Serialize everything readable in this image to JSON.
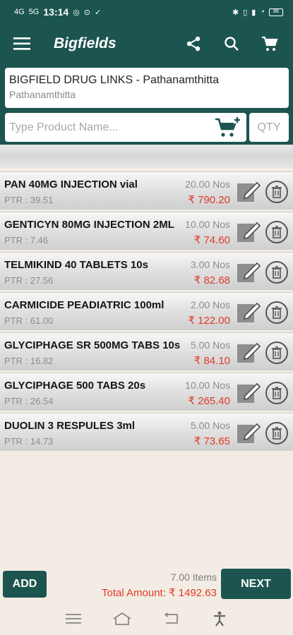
{
  "status_bar": {
    "network": "4G",
    "network2": "5G",
    "time": "13:14",
    "battery": "88"
  },
  "toolbar": {
    "title": "Bigfields"
  },
  "customer": {
    "name": "BIGFIELD DRUG LINKS - Pathanamthitta",
    "city": "Pathanamthitta"
  },
  "search": {
    "placeholder": "Type Product Name...",
    "qty_placeholder": "QTY"
  },
  "items": [
    {
      "name": "PAN 40MG INJECTION vial",
      "ptr": "PTR : 39.51",
      "qty": "20.00 Nos",
      "amount": "₹ 790.20"
    },
    {
      "name": "GENTICYN 80MG INJECTION 2ML",
      "ptr": "PTR : 7.46",
      "qty": "10.00 Nos",
      "amount": "₹ 74.60"
    },
    {
      "name": "TELMIKIND 40 TABLETS 10s",
      "ptr": "PTR : 27.56",
      "qty": "3.00 Nos",
      "amount": "₹ 82.68"
    },
    {
      "name": "CARMICIDE PEADIATRIC 100ml",
      "ptr": "PTR : 61.00",
      "qty": "2.00 Nos",
      "amount": "₹ 122.00"
    },
    {
      "name": "GLYCIPHAGE SR 500MG TABS 10s",
      "ptr": "PTR : 16.82",
      "qty": "5.00 Nos",
      "amount": "₹ 84.10"
    },
    {
      "name": "GLYCIPHAGE 500 TABS 20s",
      "ptr": "PTR : 26.54",
      "qty": "10.00 Nos",
      "amount": "₹ 265.40"
    },
    {
      "name": "DUOLIN 3 RESPULES 3ml",
      "ptr": "PTR : 14.73",
      "qty": "5.00 Nos",
      "amount": "₹ 73.65"
    }
  ],
  "footer": {
    "add_label": "ADD",
    "items_count": "7.00 Items",
    "total": "Total Amount: ₹ 1492.63",
    "next_label": "NEXT"
  },
  "colors": {
    "primary": "#1c5550",
    "amount": "#e03a26",
    "background": "#f3ece4"
  },
  "icons": [
    "menu-icon",
    "share-icon",
    "search-icon",
    "cart-icon",
    "cart-add-icon",
    "edit-icon",
    "delete-icon",
    "nav-menu-icon",
    "nav-home-icon",
    "nav-back-icon",
    "accessibility-icon"
  ]
}
